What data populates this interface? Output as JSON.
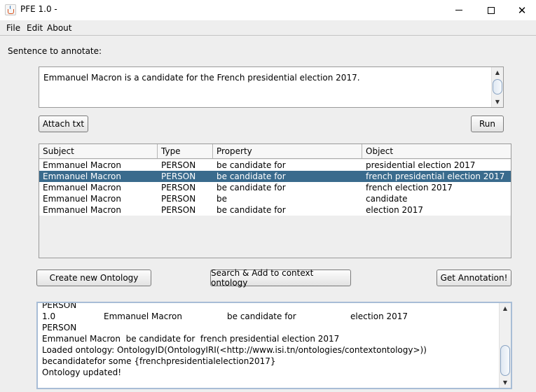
{
  "window": {
    "title": "PFE 1.0 -"
  },
  "menu": [
    "File",
    "Edit",
    "About"
  ],
  "sentence": {
    "label": "Sentence to annotate:",
    "value": "Emmanuel Macron is a candidate for the French presidential election 2017."
  },
  "buttons": {
    "attach": "Attach txt",
    "run": "Run",
    "create_ontology": "Create new Ontology",
    "search_add": "Search & Add to context ontology",
    "get_annotation": "Get Annotation!"
  },
  "table": {
    "columns": [
      "Subject",
      "Type",
      "Property",
      "Object"
    ],
    "rows": [
      [
        "Emmanuel Macron",
        "PERSON",
        "be candidate for",
        "presidential election 2017"
      ],
      [
        "Emmanuel Macron",
        "PERSON",
        "be candidate for",
        "french presidential election 2017"
      ],
      [
        "Emmanuel Macron",
        "PERSON",
        "be candidate for",
        "french election 2017"
      ],
      [
        "Emmanuel Macron",
        "PERSON",
        "be",
        "candidate"
      ],
      [
        "Emmanuel Macron",
        "PERSON",
        "be candidate for",
        "election 2017"
      ]
    ],
    "selected_row": 1
  },
  "console": {
    "lines": [
      "PERSON",
      [
        "1.0",
        "Emmanuel Macron",
        "be candidate for",
        "election 2017"
      ],
      "PERSON",
      "Emmanuel Macron  be candidate for  french presidential election 2017",
      "Loaded ontology: OntologyID(OntologyIRI(<http://www.isi.tn/ontologies/contextontology>))",
      "becandidatefor some {frenchpresidentialelection2017}",
      "Ontology updated!"
    ]
  },
  "colors": {
    "selection": "#3a6b8d",
    "scroll_border": "#a8bdd6"
  }
}
